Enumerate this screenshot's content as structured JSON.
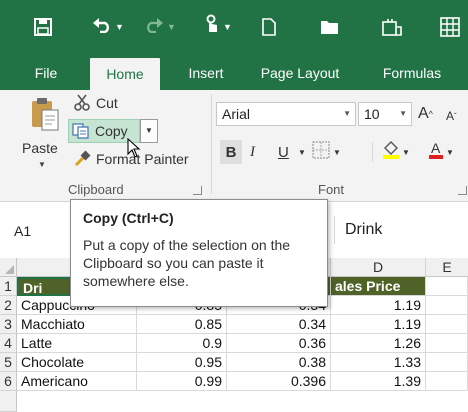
{
  "quick_access": {
    "save_icon": "save-icon",
    "undo_icon": "undo-icon",
    "redo_icon": "redo-icon",
    "touch_icon": "touch-mode-icon",
    "new_icon": "new-file-icon",
    "open_icon": "open-folder-icon",
    "screenshot_icon": "screenshot-icon",
    "more_icon": "table-icon"
  },
  "tabs": [
    {
      "label": "File",
      "active": false
    },
    {
      "label": "Home",
      "active": true
    },
    {
      "label": "Insert",
      "active": false
    },
    {
      "label": "Page Layout",
      "active": false
    },
    {
      "label": "Formulas",
      "active": false
    }
  ],
  "clipboard": {
    "paste_label": "Paste",
    "cut_label": "Cut",
    "copy_label": "Copy",
    "format_painter_label": "Format Painter",
    "group_label": "Clipboard"
  },
  "font": {
    "name": "Arial",
    "size": "10",
    "bold": "B",
    "italic": "I",
    "underline": "U",
    "grow": "A",
    "shrink": "A",
    "group_label": "Font",
    "fill_color": "#ffff00",
    "font_color": "#e02020"
  },
  "formula_bar": {
    "name_box": "A1",
    "content": "Drink"
  },
  "tooltip": {
    "title": "Copy (Ctrl+C)",
    "body": "Put a copy of the selection on the Clipboard so you can paste it somewhere else."
  },
  "sheet": {
    "columns": [
      "D",
      "E"
    ],
    "header_row": {
      "a": "Dri",
      "d": "ales Price"
    },
    "rows": [
      {
        "num": "1"
      },
      {
        "num": "2",
        "drink": "Cappuccino",
        "b": "0.85",
        "c": "0.34",
        "d": "1.19"
      },
      {
        "num": "3",
        "drink": "Macchiato",
        "b": "0.85",
        "c": "0.34",
        "d": "1.19"
      },
      {
        "num": "4",
        "drink": "Latte",
        "b": "0.9",
        "c": "0.36",
        "d": "1.26"
      },
      {
        "num": "5",
        "drink": "Chocolate",
        "b": "0.95",
        "c": "0.38",
        "d": "1.33"
      },
      {
        "num": "6",
        "drink": "Americano",
        "b": "0.99",
        "c": "0.396",
        "d": "1.39"
      }
    ],
    "header_color": "#4f6228"
  },
  "colors": {
    "accent": "#217346"
  }
}
